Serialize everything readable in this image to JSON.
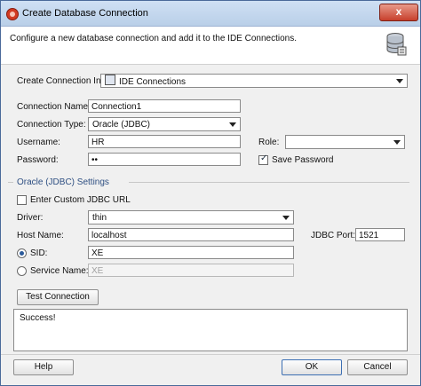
{
  "window": {
    "title": "Create Database Connection",
    "close_label": "x"
  },
  "header": {
    "description": "Configure a new database connection and add it to the IDE Connections."
  },
  "form": {
    "create_in_label": "Create Connection In:",
    "create_in_value": "IDE Connections",
    "connection_name_label": "Connection Name:",
    "connection_name_value": "Connection1",
    "connection_type_label": "Connection Type:",
    "connection_type_value": "Oracle (JDBC)",
    "username_label": "Username:",
    "username_value": "HR",
    "role_label": "Role:",
    "role_value": "",
    "password_label": "Password:",
    "password_value": "••",
    "save_password_label": "Save Password",
    "save_password_checked": true
  },
  "settings": {
    "group_label": "Oracle (JDBC) Settings",
    "custom_url_label": "Enter Custom JDBC URL",
    "driver_label": "Driver:",
    "driver_value": "thin",
    "host_label": "Host Name:",
    "host_value": "localhost",
    "port_label": "JDBC Port:",
    "port_value": "1521",
    "sid_label": "SID:",
    "sid_value": "XE",
    "service_label": "Service Name:",
    "service_value": "XE"
  },
  "test": {
    "button_label": "Test Connection",
    "status_text": "Success!"
  },
  "footer": {
    "help_label": "Help",
    "ok_label": "OK",
    "cancel_label": "Cancel"
  }
}
